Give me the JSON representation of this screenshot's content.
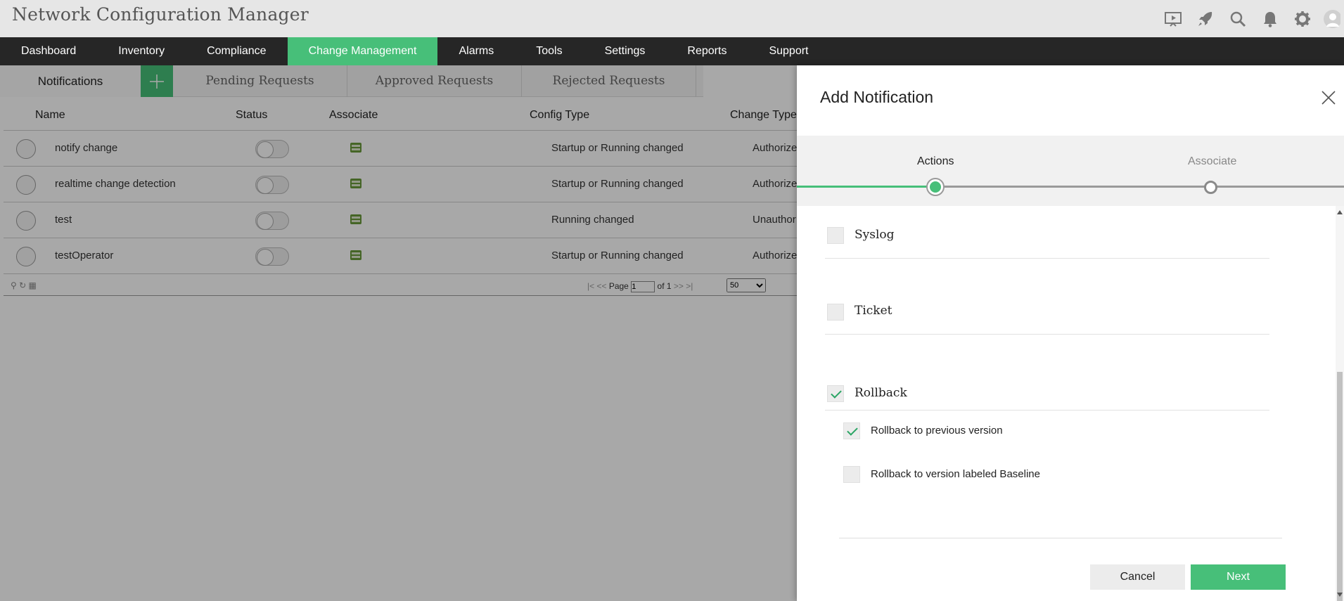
{
  "app": {
    "title": "Network Configuration Manager"
  },
  "header_icons": [
    "presentation-icon",
    "rocket-icon",
    "search-icon",
    "bell-icon",
    "gear-icon",
    "user-avatar-icon"
  ],
  "nav": {
    "items": [
      {
        "label": "Dashboard"
      },
      {
        "label": "Inventory"
      },
      {
        "label": "Compliance"
      },
      {
        "label": "Change Management",
        "active": true
      },
      {
        "label": "Alarms"
      },
      {
        "label": "Tools"
      },
      {
        "label": "Settings"
      },
      {
        "label": "Reports"
      },
      {
        "label": "Support"
      }
    ]
  },
  "subtabs": {
    "notifications": "Notifications",
    "pending": "Pending Requests",
    "approved": "Approved Requests",
    "rejected": "Rejected Requests"
  },
  "table": {
    "columns": {
      "name": "Name",
      "status": "Status",
      "associate": "Associate",
      "config_type": "Config Type",
      "change_type": "Change Type"
    },
    "rows": [
      {
        "name": "notify change",
        "config_type": "Startup or Running changed",
        "change_type": "Authorize"
      },
      {
        "name": "realtime change detection",
        "config_type": "Startup or Running changed",
        "change_type": "Authorize"
      },
      {
        "name": "test",
        "config_type": "Running changed",
        "change_type": "Unauthor"
      },
      {
        "name": "testOperator",
        "config_type": "Startup or Running changed",
        "change_type": "Authorize"
      }
    ],
    "pager": {
      "page_label": "Page",
      "page_value": "1",
      "of_label": "of 1",
      "page_size": "50"
    }
  },
  "panel": {
    "title": "Add Notification",
    "steps": {
      "actions": "Actions",
      "associate": "Associate"
    },
    "options": {
      "syslog": {
        "label": "Syslog",
        "checked": false
      },
      "ticket": {
        "label": "Ticket",
        "checked": false
      },
      "rollback": {
        "label": "Rollback",
        "checked": true
      }
    },
    "rollback_options": {
      "previous": {
        "label": "Rollback to previous version",
        "checked": true
      },
      "baseline": {
        "label": "Rollback to version labeled Baseline",
        "checked": false
      }
    },
    "buttons": {
      "cancel": "Cancel",
      "next": "Next"
    }
  },
  "colors": {
    "accent": "#47bf79",
    "navbar": "#262626",
    "header": "#e6e6e6"
  }
}
